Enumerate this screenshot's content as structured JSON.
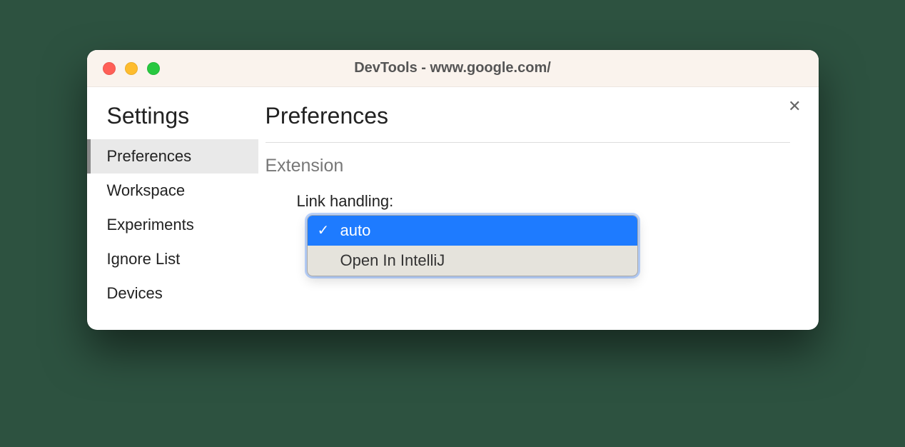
{
  "window": {
    "title": "DevTools - www.google.com/"
  },
  "sidebar": {
    "title": "Settings",
    "items": [
      {
        "label": "Preferences",
        "active": true
      },
      {
        "label": "Workspace"
      },
      {
        "label": "Experiments"
      },
      {
        "label": "Ignore List"
      },
      {
        "label": "Devices"
      }
    ]
  },
  "main": {
    "title": "Preferences",
    "section": "Extension",
    "setting_label": "Link handling:",
    "dropdown": {
      "options": [
        {
          "label": "auto",
          "selected": true
        },
        {
          "label": "Open In IntelliJ"
        }
      ]
    }
  }
}
